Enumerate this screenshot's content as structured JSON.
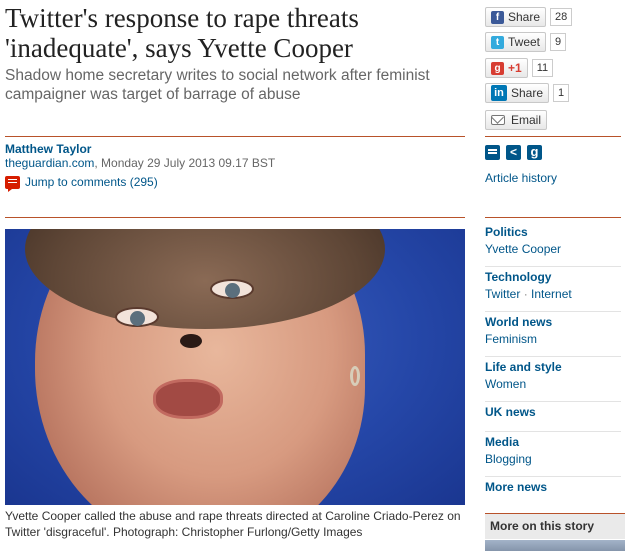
{
  "article": {
    "headline": "Twitter's response to rape threats 'inadequate', says Yvette Cooper",
    "standfirst": "Shadow home secretary writes to social network after feminist campaigner was target of barrage of abuse",
    "author": "Matthew Taylor",
    "source": "theguardian.com",
    "date": ", Monday 29 July 2013 09.17 BST",
    "comments_link": "Jump to comments (295)",
    "caption": "Yvette Cooper called the abuse and rape threats directed at Caroline Criado-Perez on Twitter 'disgraceful'. Photograph: Christopher Furlong/Getty Images"
  },
  "share": {
    "facebook": {
      "label": "Share",
      "count": "28",
      "icon": "f"
    },
    "twitter": {
      "label": "Tweet",
      "count": "9",
      "icon": "t"
    },
    "googleplus": {
      "label": "+1",
      "count": "11",
      "icon": "g"
    },
    "linkedin": {
      "label": "Share",
      "count": "1",
      "icon": "in"
    },
    "email": {
      "label": "Email"
    }
  },
  "tools": {
    "article_history": "Article history"
  },
  "tags": [
    {
      "heading": "Politics",
      "items": [
        "Yvette Cooper"
      ]
    },
    {
      "heading": "Technology",
      "items": [
        "Twitter",
        "Internet"
      ]
    },
    {
      "heading": "World news",
      "items": [
        "Feminism"
      ]
    },
    {
      "heading": "Life and style",
      "items": [
        "Women"
      ]
    },
    {
      "heading": "UK news",
      "items": []
    },
    {
      "heading": "Media",
      "items": [
        "Blogging"
      ]
    },
    {
      "heading": "More news",
      "items": []
    }
  ],
  "tag_separator": "·",
  "more_on_story": "More on this story",
  "colors": {
    "link_blue": "#005689",
    "rule_orange": "#b8522a",
    "comment_red": "#d61d00"
  }
}
